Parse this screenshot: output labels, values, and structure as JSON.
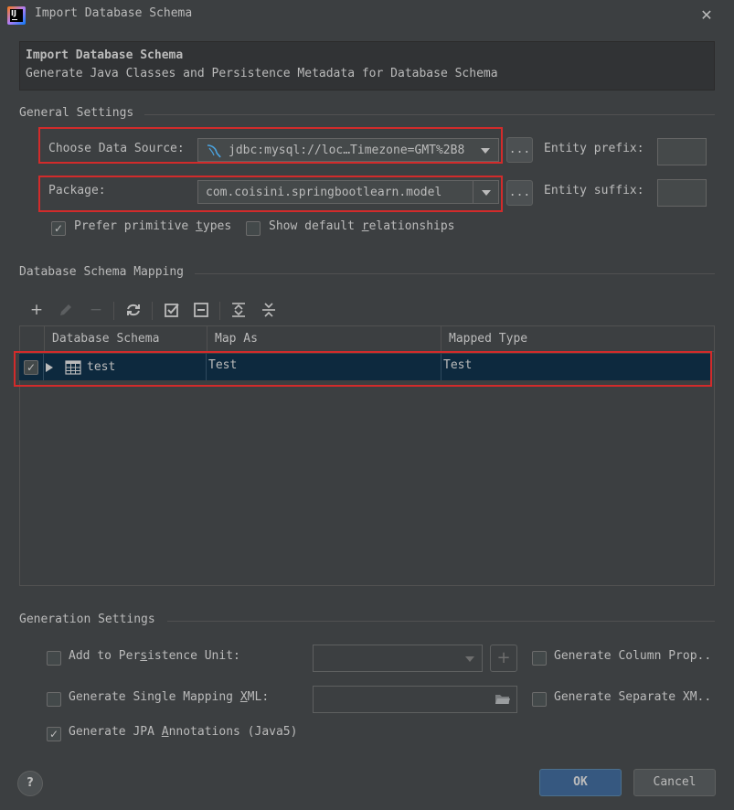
{
  "window": {
    "title": "Import Database Schema",
    "app_icon": "intellij-idea-icon",
    "close_label": "✕"
  },
  "header": {
    "title": "Import Database Schema",
    "subtitle": "Generate Java Classes and Persistence Metadata for Database Schema"
  },
  "general": {
    "section_label": "General Settings",
    "data_source_label": "Choose Data Source:",
    "data_source_value": "jdbc:mysql://loc…Timezone=GMT%2B8",
    "package_label": "Package:",
    "package_value": "com.coisini.springbootlearn.model",
    "browse_label": "...",
    "entity_prefix_label": "Entity prefix:",
    "entity_prefix_value": "",
    "entity_suffix_label": "Entity suffix:",
    "entity_suffix_value": "",
    "prefer_primitive": {
      "pre": "Prefer primitive ",
      "mnemonic": "t",
      "post": "ypes",
      "checked": true
    },
    "show_default": {
      "pre": "Show default ",
      "mnemonic": "r",
      "post": "elationships",
      "checked": false
    }
  },
  "mapping": {
    "section_label": "Database Schema Mapping",
    "toolbar": [
      "add-icon",
      "edit-icon",
      "remove-icon",
      "refresh-icon",
      "check-all-icon",
      "uncheck-all-icon",
      "expand-all-icon",
      "collapse-all-icon"
    ],
    "columns": [
      "Database Schema",
      "Map As",
      "Mapped Type"
    ],
    "rows": [
      {
        "checked": true,
        "schema": "test",
        "map_as": "Test",
        "mapped_type": "Test"
      }
    ]
  },
  "generation": {
    "section_label": "Generation Settings",
    "persistence_unit": {
      "pre": "Add to Per",
      "mnemonic": "s",
      "post": "istence Unit:",
      "checked": false
    },
    "single_mapping": {
      "pre": "Generate Single Mapping ",
      "mnemonic": "X",
      "post": "ML:",
      "checked": false
    },
    "jpa_annotations": {
      "pre": "Generate JPA ",
      "mnemonic": "A",
      "post": "nnotations (Java5)",
      "checked": true
    },
    "column_prop": {
      "label": "Generate Column Prop..",
      "checked": false
    },
    "separate_xml": {
      "label": "Generate Separate XM..",
      "checked": false
    },
    "plus_label": "+"
  },
  "footer": {
    "help_label": "?",
    "ok_label": "OK",
    "cancel_label": "Cancel"
  },
  "colors": {
    "background": "#3c3f41",
    "highlight_red": "#d22b2b",
    "selected_row": "#0d293e",
    "ok_button": "#365880"
  }
}
